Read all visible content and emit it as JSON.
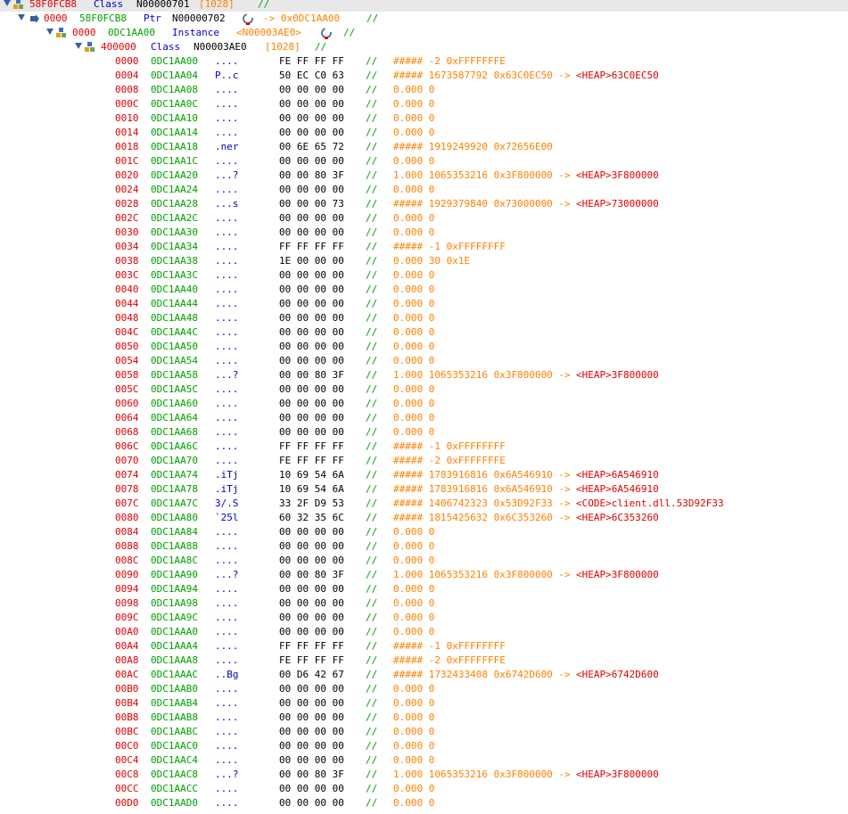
{
  "headers": [
    {
      "prefix": "",
      "offset": "58F0FCB8",
      "address": "",
      "type": "Class",
      "name": "N00000701",
      "size": "[1028]",
      "comment": "//"
    },
    {
      "prefix": "0000",
      "address": "58F0FCB8",
      "type": "Ptr",
      "name": "N00000702",
      "arrow": "-> 0x0DC1AA00",
      "comment": "//"
    },
    {
      "prefix": "0000",
      "address": "0DC1AA00",
      "type": "Instance",
      "name": "<N00003AE0>",
      "comment": "//"
    },
    {
      "prefix": "400000",
      "type": "Class",
      "name": "N00003AE0",
      "size": "[1028]",
      "comment": "//"
    }
  ],
  "rows": [
    {
      "off": "0000",
      "addr": "0DC1AA00",
      "ascii": "....",
      "hex": "FE FF FF FF",
      "cmt": "//",
      "dec": "##### -2 0xFFFFFFFE",
      "ptr": ""
    },
    {
      "off": "0004",
      "addr": "0DC1AA04",
      "ascii": "P..c",
      "hex": "50 EC C0 63",
      "cmt": "//",
      "dec": "##### 1673587792 0x63C0EC50 ->",
      "ptr": "<HEAP>63C0EC50"
    },
    {
      "off": "0008",
      "addr": "0DC1AA08",
      "ascii": "....",
      "hex": "00 00 00 00",
      "cmt": "//",
      "dec": "0.000 0",
      "ptr": ""
    },
    {
      "off": "000C",
      "addr": "0DC1AA0C",
      "ascii": "....",
      "hex": "00 00 00 00",
      "cmt": "//",
      "dec": "0.000 0",
      "ptr": ""
    },
    {
      "off": "0010",
      "addr": "0DC1AA10",
      "ascii": "....",
      "hex": "00 00 00 00",
      "cmt": "//",
      "dec": "0.000 0",
      "ptr": ""
    },
    {
      "off": "0014",
      "addr": "0DC1AA14",
      "ascii": "....",
      "hex": "00 00 00 00",
      "cmt": "//",
      "dec": "0.000 0",
      "ptr": ""
    },
    {
      "off": "0018",
      "addr": "0DC1AA18",
      "ascii": ".ner",
      "hex": "00 6E 65 72",
      "cmt": "//",
      "dec": "##### 1919249920 0x72656E00",
      "ptr": ""
    },
    {
      "off": "001C",
      "addr": "0DC1AA1C",
      "ascii": "....",
      "hex": "00 00 00 00",
      "cmt": "//",
      "dec": "0.000 0",
      "ptr": ""
    },
    {
      "off": "0020",
      "addr": "0DC1AA20",
      "ascii": "...?",
      "hex": "00 00 80 3F",
      "cmt": "//",
      "dec": "1.000 1065353216 0x3F800000 ->",
      "ptr": "<HEAP>3F800000"
    },
    {
      "off": "0024",
      "addr": "0DC1AA24",
      "ascii": "....",
      "hex": "00 00 00 00",
      "cmt": "//",
      "dec": "0.000 0",
      "ptr": ""
    },
    {
      "off": "0028",
      "addr": "0DC1AA28",
      "ascii": "...s",
      "hex": "00 00 00 73",
      "cmt": "//",
      "dec": "##### 1929379840 0x73000000 ->",
      "ptr": "<HEAP>73000000"
    },
    {
      "off": "002C",
      "addr": "0DC1AA2C",
      "ascii": "....",
      "hex": "00 00 00 00",
      "cmt": "//",
      "dec": "0.000 0",
      "ptr": ""
    },
    {
      "off": "0030",
      "addr": "0DC1AA30",
      "ascii": "....",
      "hex": "00 00 00 00",
      "cmt": "//",
      "dec": "0.000 0",
      "ptr": ""
    },
    {
      "off": "0034",
      "addr": "0DC1AA34",
      "ascii": "....",
      "hex": "FF FF FF FF",
      "cmt": "//",
      "dec": "##### -1 0xFFFFFFFF",
      "ptr": ""
    },
    {
      "off": "0038",
      "addr": "0DC1AA38",
      "ascii": "....",
      "hex": "1E 00 00 00",
      "cmt": "//",
      "dec": "0.000 30 0x1E",
      "ptr": ""
    },
    {
      "off": "003C",
      "addr": "0DC1AA3C",
      "ascii": "....",
      "hex": "00 00 00 00",
      "cmt": "//",
      "dec": "0.000 0",
      "ptr": ""
    },
    {
      "off": "0040",
      "addr": "0DC1AA40",
      "ascii": "....",
      "hex": "00 00 00 00",
      "cmt": "//",
      "dec": "0.000 0",
      "ptr": ""
    },
    {
      "off": "0044",
      "addr": "0DC1AA44",
      "ascii": "....",
      "hex": "00 00 00 00",
      "cmt": "//",
      "dec": "0.000 0",
      "ptr": ""
    },
    {
      "off": "0048",
      "addr": "0DC1AA48",
      "ascii": "....",
      "hex": "00 00 00 00",
      "cmt": "//",
      "dec": "0.000 0",
      "ptr": ""
    },
    {
      "off": "004C",
      "addr": "0DC1AA4C",
      "ascii": "....",
      "hex": "00 00 00 00",
      "cmt": "//",
      "dec": "0.000 0",
      "ptr": ""
    },
    {
      "off": "0050",
      "addr": "0DC1AA50",
      "ascii": "....",
      "hex": "00 00 00 00",
      "cmt": "//",
      "dec": "0.000 0",
      "ptr": ""
    },
    {
      "off": "0054",
      "addr": "0DC1AA54",
      "ascii": "....",
      "hex": "00 00 00 00",
      "cmt": "//",
      "dec": "0.000 0",
      "ptr": ""
    },
    {
      "off": "0058",
      "addr": "0DC1AA58",
      "ascii": "...?",
      "hex": "00 00 80 3F",
      "cmt": "//",
      "dec": "1.000 1065353216 0x3F800000 ->",
      "ptr": "<HEAP>3F800000"
    },
    {
      "off": "005C",
      "addr": "0DC1AA5C",
      "ascii": "....",
      "hex": "00 00 00 00",
      "cmt": "//",
      "dec": "0.000 0",
      "ptr": ""
    },
    {
      "off": "0060",
      "addr": "0DC1AA60",
      "ascii": "....",
      "hex": "00 00 00 00",
      "cmt": "//",
      "dec": "0.000 0",
      "ptr": ""
    },
    {
      "off": "0064",
      "addr": "0DC1AA64",
      "ascii": "....",
      "hex": "00 00 00 00",
      "cmt": "//",
      "dec": "0.000 0",
      "ptr": ""
    },
    {
      "off": "0068",
      "addr": "0DC1AA68",
      "ascii": "....",
      "hex": "00 00 00 00",
      "cmt": "//",
      "dec": "0.000 0",
      "ptr": ""
    },
    {
      "off": "006C",
      "addr": "0DC1AA6C",
      "ascii": "....",
      "hex": "FF FF FF FF",
      "cmt": "//",
      "dec": "##### -1 0xFFFFFFFF",
      "ptr": ""
    },
    {
      "off": "0070",
      "addr": "0DC1AA70",
      "ascii": "....",
      "hex": "FE FF FF FF",
      "cmt": "//",
      "dec": "##### -2 0xFFFFFFFE",
      "ptr": ""
    },
    {
      "off": "0074",
      "addr": "0DC1AA74",
      "ascii": ".iTj",
      "hex": "10 69 54 6A",
      "cmt": "//",
      "dec": "##### 1783916816 0x6A546910 ->",
      "ptr": "<HEAP>6A546910"
    },
    {
      "off": "0078",
      "addr": "0DC1AA78",
      "ascii": ".iTj",
      "hex": "10 69 54 6A",
      "cmt": "//",
      "dec": "##### 1783916816 0x6A546910 ->",
      "ptr": "<HEAP>6A546910"
    },
    {
      "off": "007C",
      "addr": "0DC1AA7C",
      "ascii": "3/.S",
      "hex": "33 2F D9 53",
      "cmt": "//",
      "dec": "##### 1406742323 0x53D92F33 ->",
      "ptr": "<CODE>client.dll.53D92F33"
    },
    {
      "off": "0080",
      "addr": "0DC1AA80",
      "ascii": "`25l",
      "hex": "60 32 35 6C",
      "cmt": "//",
      "dec": "##### 1815425632 0x6C353260 ->",
      "ptr": "<HEAP>6C353260"
    },
    {
      "off": "0084",
      "addr": "0DC1AA84",
      "ascii": "....",
      "hex": "00 00 00 00",
      "cmt": "//",
      "dec": "0.000 0",
      "ptr": ""
    },
    {
      "off": "0088",
      "addr": "0DC1AA88",
      "ascii": "....",
      "hex": "00 00 00 00",
      "cmt": "//",
      "dec": "0.000 0",
      "ptr": ""
    },
    {
      "off": "008C",
      "addr": "0DC1AA8C",
      "ascii": "....",
      "hex": "00 00 00 00",
      "cmt": "//",
      "dec": "0.000 0",
      "ptr": ""
    },
    {
      "off": "0090",
      "addr": "0DC1AA90",
      "ascii": "...?",
      "hex": "00 00 80 3F",
      "cmt": "//",
      "dec": "1.000 1065353216 0x3F800000 ->",
      "ptr": "<HEAP>3F800000"
    },
    {
      "off": "0094",
      "addr": "0DC1AA94",
      "ascii": "....",
      "hex": "00 00 00 00",
      "cmt": "//",
      "dec": "0.000 0",
      "ptr": ""
    },
    {
      "off": "0098",
      "addr": "0DC1AA98",
      "ascii": "....",
      "hex": "00 00 00 00",
      "cmt": "//",
      "dec": "0.000 0",
      "ptr": ""
    },
    {
      "off": "009C",
      "addr": "0DC1AA9C",
      "ascii": "....",
      "hex": "00 00 00 00",
      "cmt": "//",
      "dec": "0.000 0",
      "ptr": ""
    },
    {
      "off": "00A0",
      "addr": "0DC1AAA0",
      "ascii": "....",
      "hex": "00 00 00 00",
      "cmt": "//",
      "dec": "0.000 0",
      "ptr": ""
    },
    {
      "off": "00A4",
      "addr": "0DC1AAA4",
      "ascii": "....",
      "hex": "FF FF FF FF",
      "cmt": "//",
      "dec": "##### -1 0xFFFFFFFF",
      "ptr": ""
    },
    {
      "off": "00A8",
      "addr": "0DC1AAA8",
      "ascii": "....",
      "hex": "FE FF FF FF",
      "cmt": "//",
      "dec": "##### -2 0xFFFFFFFE",
      "ptr": ""
    },
    {
      "off": "00AC",
      "addr": "0DC1AAAC",
      "ascii": "..Bg",
      "hex": "00 D6 42 67",
      "cmt": "//",
      "dec": "##### 1732433408 0x6742D600 ->",
      "ptr": "<HEAP>6742D600"
    },
    {
      "off": "00B0",
      "addr": "0DC1AAB0",
      "ascii": "....",
      "hex": "00 00 00 00",
      "cmt": "//",
      "dec": "0.000 0",
      "ptr": ""
    },
    {
      "off": "00B4",
      "addr": "0DC1AAB4",
      "ascii": "....",
      "hex": "00 00 00 00",
      "cmt": "//",
      "dec": "0.000 0",
      "ptr": ""
    },
    {
      "off": "00B8",
      "addr": "0DC1AAB8",
      "ascii": "....",
      "hex": "00 00 00 00",
      "cmt": "//",
      "dec": "0.000 0",
      "ptr": ""
    },
    {
      "off": "00BC",
      "addr": "0DC1AABC",
      "ascii": "....",
      "hex": "00 00 00 00",
      "cmt": "//",
      "dec": "0.000 0",
      "ptr": ""
    },
    {
      "off": "00C0",
      "addr": "0DC1AAC0",
      "ascii": "....",
      "hex": "00 00 00 00",
      "cmt": "//",
      "dec": "0.000 0",
      "ptr": ""
    },
    {
      "off": "00C4",
      "addr": "0DC1AAC4",
      "ascii": "....",
      "hex": "00 00 00 00",
      "cmt": "//",
      "dec": "0.000 0",
      "ptr": ""
    },
    {
      "off": "00C8",
      "addr": "0DC1AAC8",
      "ascii": "...?",
      "hex": "00 00 80 3F",
      "cmt": "//",
      "dec": "1.000 1065353216 0x3F800000 ->",
      "ptr": "<HEAP>3F800000"
    },
    {
      "off": "00CC",
      "addr": "0DC1AACC",
      "ascii": "....",
      "hex": "00 00 00 00",
      "cmt": "//",
      "dec": "0.000 0",
      "ptr": ""
    },
    {
      "off": "00D0",
      "addr": "0DC1AAD0",
      "ascii": "....",
      "hex": "00 00 00 00",
      "cmt": "//",
      "dec": "0.000 0",
      "ptr": ""
    }
  ],
  "colors": {
    "offset": "#e00000",
    "address": "#00a000",
    "type": "#0000cc",
    "comment": "#00a000",
    "value": "#ff8000",
    "pointer": "#e00000"
  },
  "icons": {
    "expand": "caret-down-icon",
    "node": "class-node-icon",
    "pointer": "pointer-icon",
    "refresh": "refresh-icon"
  }
}
